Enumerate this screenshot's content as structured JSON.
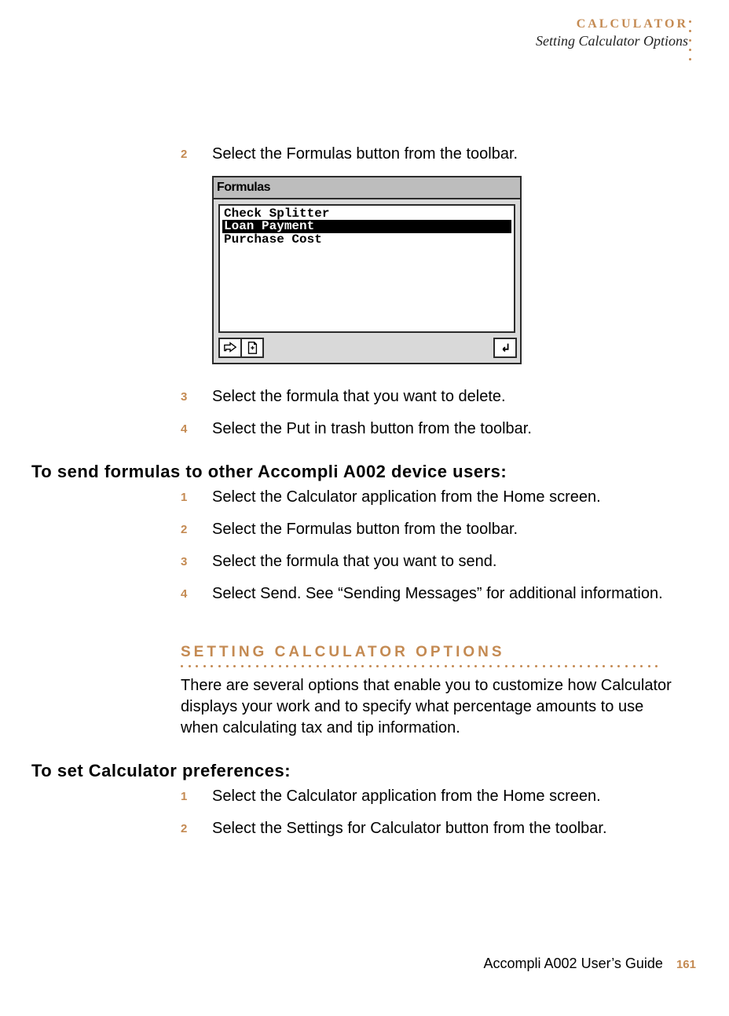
{
  "header": {
    "chapter": "CALCULATOR",
    "section": "Setting Calculator Options"
  },
  "block1": {
    "steps": [
      {
        "n": "2",
        "t": "Select the Formulas button from the toolbar."
      },
      {
        "n": "3",
        "t": "Select the formula that you want to delete."
      },
      {
        "n": "4",
        "t": "Select the Put in trash button from the toolbar."
      }
    ]
  },
  "screenshot": {
    "title": "Formulas",
    "items": {
      "a": "Check Splitter",
      "b": "Loan Payment",
      "c": "Purchase Cost"
    }
  },
  "sub1": {
    "title": "To send formulas to other Accompli A002 device users:",
    "steps": [
      {
        "n": "1",
        "t": "Select the Calculator application from the Home screen."
      },
      {
        "n": "2",
        "t": "Select the Formulas button from the toolbar."
      },
      {
        "n": "3",
        "t": "Select the formula that you want to send."
      },
      {
        "n": "4",
        "t": "Select Send. See “Sending Messages” for additional information."
      }
    ]
  },
  "section2": {
    "title": "SETTING CALCULATOR OPTIONS",
    "para": "There are several options that enable you to customize how Calculator displays your work and to specify what percentage amounts to use when calculating tax and tip information."
  },
  "sub2": {
    "title": "To set Calculator preferences:",
    "steps": [
      {
        "n": "1",
        "t": "Select the Calculator application from the Home screen."
      },
      {
        "n": "2",
        "t": "Select the Settings for Calculator button from the toolbar."
      }
    ]
  },
  "footer": {
    "guide": "Accompli A002 User’s Guide",
    "page": "161"
  }
}
